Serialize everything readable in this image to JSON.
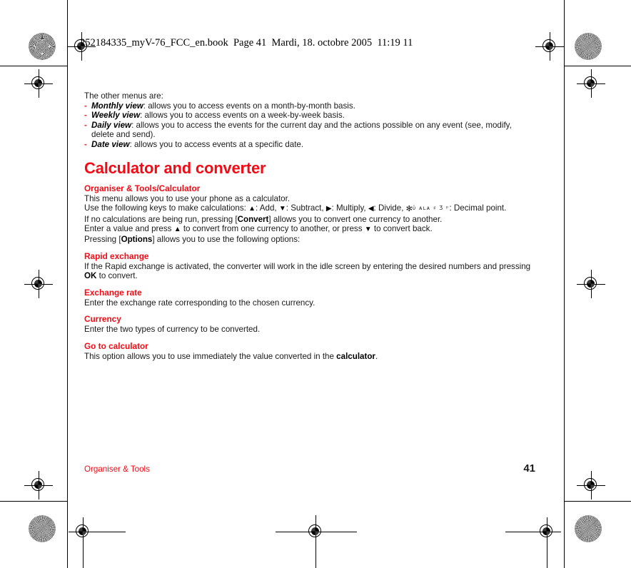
{
  "header": {
    "slug": "252184335_myV-76_FCC_en.book  Page 41  Mardi, 18. octobre 2005  11:19 11"
  },
  "colors": {
    "heading_red": "#f50a14",
    "body_black": "#1a1a1a",
    "dash_red": "#e8262d"
  },
  "content": {
    "intro": "The other menus are:",
    "menu_items": [
      {
        "dash": "-",
        "term": "Monthly view",
        "desc": ": allows you to access events on a month-by-month basis."
      },
      {
        "dash": "-",
        "term": "Weekly view",
        "desc": ": allows you to access events on a week-by-week basis."
      },
      {
        "dash": "-",
        "term": "Daily view",
        "desc": ": allows you to access the events for the current day and the actions possible on any event (see, modify, delete and send)."
      },
      {
        "dash": "-",
        "term": "Date view",
        "desc": ": allows you to access events at a specific date."
      }
    ],
    "title": "Calculator and converter",
    "subtitle": "Organiser & Tools/Calculator",
    "p_intro": "This menu allows you to use your phone as a calculator.",
    "keys_prefix": "Use the following keys to make calculations: ",
    "keys": [
      {
        "glyph": "▲",
        "label": ": Add, "
      },
      {
        "glyph": "▼",
        "label": ": Subtract, "
      },
      {
        "glyph": "▶",
        "label": ": Multiply, "
      },
      {
        "glyph": "◀",
        "label": ": Divide, "
      }
    ],
    "star_glyph": "✻",
    "key_symbols": "ὐ ᴀʟᴀ ♯ Ʒ ᵖ",
    "decimal_label": ": Decimal point.",
    "p_convert_a": "If no calculations are being run, pressing [",
    "p_convert_key": "Convert",
    "p_convert_b": "] allows you to convert one currency to another.",
    "p_enter_a": "Enter a value and press ",
    "p_enter_up": "▲",
    "p_enter_b": " to convert from one currency to another, or press ",
    "p_enter_down": "▼",
    "p_enter_c": " to convert back.",
    "p_options_a": "Pressing [",
    "p_options_key": "Options",
    "p_options_b": "] allows you to use the following options:",
    "options": [
      {
        "heading": "Rapid exchange",
        "text_a": "If the Rapid exchange is activated, the converter will work in the idle screen by entering the desired numbers and pressing ",
        "bold": "OK",
        "text_b": " to convert."
      },
      {
        "heading": "Exchange rate",
        "text_a": "Enter the exchange rate corresponding to the chosen currency.",
        "bold": "",
        "text_b": ""
      },
      {
        "heading": "Currency",
        "text_a": "Enter the two types of currency to be converted.",
        "bold": "",
        "text_b": ""
      },
      {
        "heading": "Go to calculator",
        "text_a": "This option allows you to use immediately the value converted in the ",
        "bold": "calculator",
        "text_b": "."
      }
    ]
  },
  "footer": {
    "chapter": "Organiser & Tools",
    "page_number": "41"
  }
}
